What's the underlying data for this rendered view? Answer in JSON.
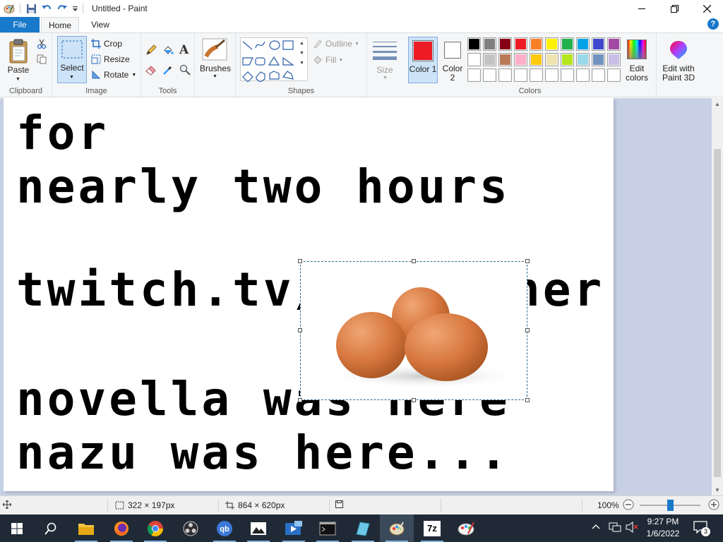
{
  "window": {
    "title": "Untitled - Paint"
  },
  "tabs": {
    "file": "File",
    "home": "Home",
    "view": "View"
  },
  "help": "?",
  "ribbon": {
    "clipboard": {
      "paste": "Paste",
      "label": "Clipboard"
    },
    "image": {
      "select": "Select",
      "crop": "Crop",
      "resize": "Resize",
      "rotate": "Rotate",
      "label": "Image"
    },
    "tools": {
      "label": "Tools"
    },
    "brushes": {
      "label": "Brushes"
    },
    "shapes": {
      "outline": "Outline",
      "fill": "Fill",
      "label": "Shapes"
    },
    "size": {
      "label": "Size"
    },
    "colors": {
      "color1_label": "Color 1",
      "color2_label": "Color 2",
      "color1_value": "#ed1c24",
      "color2_value": "#ffffff",
      "edit_colors": "Edit colors",
      "edit_paint3d": "Edit with Paint 3D",
      "label": "Colors",
      "palette": [
        "#000000",
        "#7f7f7f",
        "#880015",
        "#ed1c24",
        "#ff7f27",
        "#fff200",
        "#22b14c",
        "#00a2e8",
        "#3f48cc",
        "#a349a4",
        "#ffffff",
        "#c3c3c3",
        "#b97a57",
        "#ffaec9",
        "#ffc90e",
        "#efe4b0",
        "#b5e61d",
        "#99d9ea",
        "#7092be",
        "#c8bfe7",
        "#ffffff",
        "#ffffff",
        "#ffffff",
        "#ffffff",
        "#ffffff",
        "#ffffff",
        "#ffffff",
        "#ffffff",
        "#ffffff",
        "#ffffff"
      ]
    }
  },
  "canvas": {
    "lines": [
      "for",
      "nearly two hours",
      "twitch.tv/",
      "ner",
      "novella was here",
      "nazu was here..."
    ]
  },
  "status": {
    "selection_size": "322 × 197px",
    "canvas_size": "864 × 620px",
    "zoom": "100%"
  },
  "taskbar": {
    "time": "9:27 PM",
    "date": "1/6/2022",
    "sevenzip_label": "7z",
    "notification_count": "3"
  }
}
